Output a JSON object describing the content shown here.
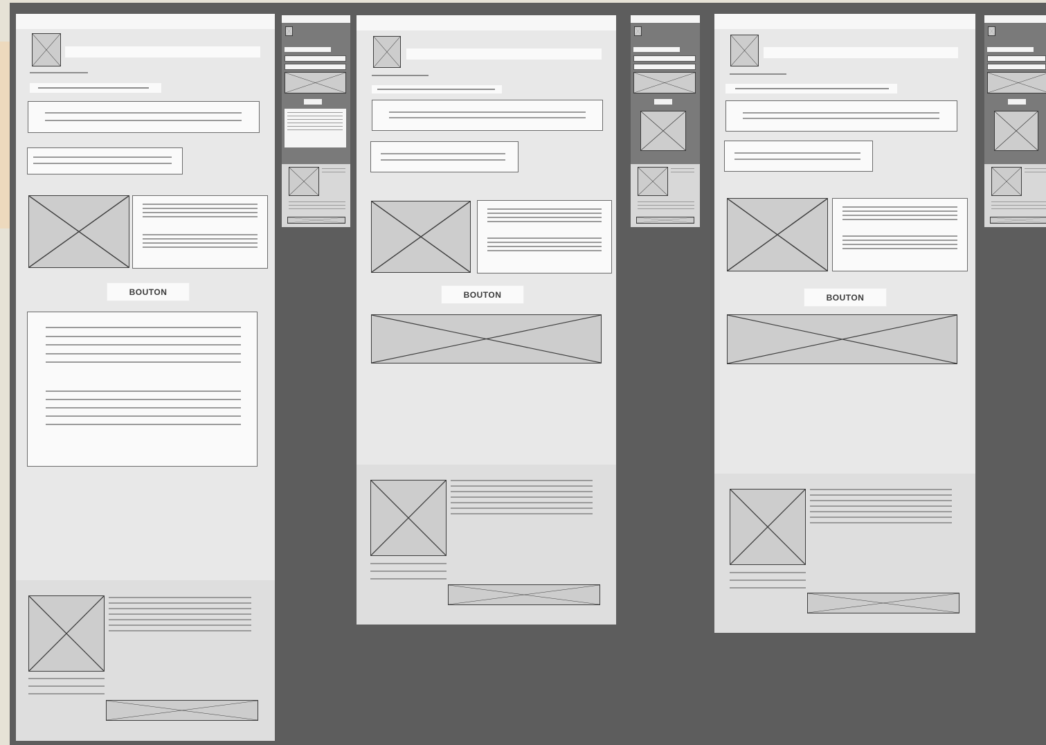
{
  "screen": {
    "accent_color": "#edd9bd",
    "canvas_color": "#5d5d5d",
    "board_color": "#e8e8e8"
  },
  "icons": {
    "placeholder": "image-placeholder-icon"
  },
  "boards": {
    "desktop_a": {
      "button_label": "BOUTON"
    },
    "desktop_b": {
      "button_label": "BOUTON"
    },
    "desktop_c": {
      "button_label": "BOUTON"
    }
  }
}
